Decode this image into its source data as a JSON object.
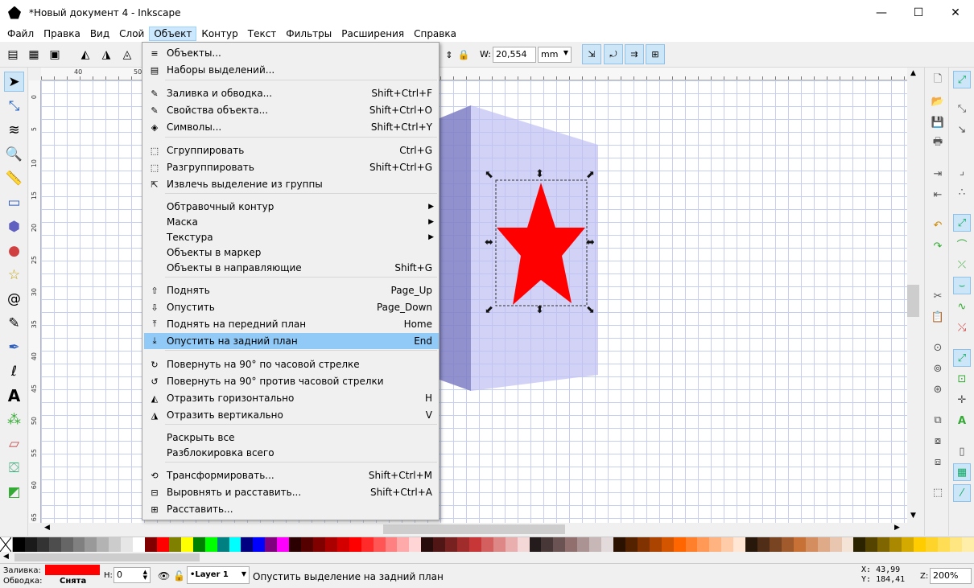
{
  "window": {
    "title": "*Новый документ 4 - Inkscape",
    "minimize": "—",
    "maximize": "☐",
    "close": "✕"
  },
  "menubar": {
    "items": [
      "Файл",
      "Правка",
      "Вид",
      "Слой",
      "Объект",
      "Контур",
      "Текст",
      "Фильтры",
      "Расширения",
      "Справка"
    ],
    "active": "Объект"
  },
  "toolbar": {
    "w_label": "W:",
    "w_value": "20,554",
    "unit": "mm"
  },
  "object_menu": {
    "items": [
      {
        "label": "Объекты...",
        "shortcut": "",
        "icon": "objects-icon"
      },
      {
        "label": "Наборы выделений...",
        "shortcut": "",
        "icon": "selection-sets-icon"
      },
      {
        "label": "Заливка и обводка...",
        "shortcut": "Shift+Ctrl+F",
        "icon": "fill-stroke-icon"
      },
      {
        "label": "Свойства объекта...",
        "shortcut": "Shift+Ctrl+O",
        "icon": "object-properties-icon"
      },
      {
        "label": "Символы...",
        "shortcut": "Shift+Ctrl+Y",
        "icon": "symbols-icon"
      },
      {
        "label": "Сгруппировать",
        "shortcut": "Ctrl+G",
        "icon": "group-icon"
      },
      {
        "label": "Разгруппировать",
        "shortcut": "Shift+Ctrl+G",
        "icon": "ungroup-icon"
      },
      {
        "label": "Извлечь выделение из группы",
        "shortcut": "",
        "icon": "pop-from-group-icon"
      },
      {
        "label": "Обтравочный контур",
        "shortcut": "",
        "icon": "",
        "submenu": true
      },
      {
        "label": "Маска",
        "shortcut": "",
        "icon": "",
        "submenu": true
      },
      {
        "label": "Текстура",
        "shortcut": "",
        "icon": "",
        "submenu": true
      },
      {
        "label": "Объекты в маркер",
        "shortcut": "",
        "icon": ""
      },
      {
        "label": "Объекты в направляющие",
        "shortcut": "Shift+G",
        "icon": ""
      },
      {
        "label": "Поднять",
        "shortcut": "Page_Up",
        "icon": "raise-icon"
      },
      {
        "label": "Опустить",
        "shortcut": "Page_Down",
        "icon": "lower-icon"
      },
      {
        "label": "Поднять на передний план",
        "shortcut": "Home",
        "icon": "raise-to-top-icon"
      },
      {
        "label": "Опустить на задний план",
        "shortcut": "End",
        "icon": "lower-to-bottom-icon",
        "highlighted": true
      },
      {
        "label": "Повернуть на 90° по часовой стрелке",
        "shortcut": "",
        "icon": "rotate-cw-icon"
      },
      {
        "label": "Повернуть на 90° против часовой стрелки",
        "shortcut": "",
        "icon": "rotate-ccw-icon"
      },
      {
        "label": "Отразить горизонтально",
        "shortcut": "H",
        "icon": "flip-horizontal-icon"
      },
      {
        "label": "Отразить вертикально",
        "shortcut": "V",
        "icon": "flip-vertical-icon"
      },
      {
        "label": "Раскрыть все",
        "shortcut": "",
        "icon": ""
      },
      {
        "label": "Разблокировка всего",
        "shortcut": "",
        "icon": ""
      },
      {
        "label": "Трансформировать...",
        "shortcut": "Shift+Ctrl+M",
        "icon": "transform-icon"
      },
      {
        "label": "Выровнять и расставить...",
        "shortcut": "Shift+Ctrl+A",
        "icon": "align-distribute-icon"
      },
      {
        "label": "Расставить...",
        "shortcut": "",
        "icon": "arrange-icon"
      }
    ]
  },
  "ruler": {
    "h_labels": [
      "40",
      "50"
    ],
    "v_labels": [
      "0",
      "5",
      "10",
      "15",
      "20",
      "25",
      "30",
      "35",
      "40",
      "45",
      "50",
      "55",
      "60",
      "65"
    ]
  },
  "palette": [
    "#000000",
    "#1a1a1a",
    "#333333",
    "#4d4d4d",
    "#666666",
    "#808080",
    "#999999",
    "#b3b3b3",
    "#cccccc",
    "#e6e6e6",
    "#ffffff",
    "#800000",
    "#ff0000",
    "#808000",
    "#ffff00",
    "#008000",
    "#00ff00",
    "#008080",
    "#00ffff",
    "#000080",
    "#0000ff",
    "#800080",
    "#ff00ff",
    "#2b0000",
    "#550000",
    "#800000",
    "#aa0000",
    "#d40000",
    "#ff0000",
    "#ff2a2a",
    "#ff5555",
    "#ff8080",
    "#ffaaaa",
    "#ffd5d5",
    "#280b0b",
    "#501616",
    "#782121",
    "#a02c2c",
    "#c83737",
    "#d35f5f",
    "#de8787",
    "#e9afaf",
    "#f4d7d7",
    "#241c1c",
    "#483737",
    "#6c5353",
    "#916f6f",
    "#ac9393",
    "#c8b7b7",
    "#e3dbdb",
    "#2b1100",
    "#552200",
    "#803300",
    "#aa4400",
    "#d45500",
    "#ff6600",
    "#ff7f2a",
    "#ff9955",
    "#ffb380",
    "#ffccaa",
    "#ffe6d5",
    "#28170b",
    "#502d16",
    "#784421",
    "#a05a2c",
    "#c87137",
    "#d38d5f",
    "#deaa87",
    "#e9c6af",
    "#f4e3d7",
    "#2b2200",
    "#554400",
    "#806600",
    "#aa8800",
    "#d4aa00",
    "#ffcc00",
    "#ffd42a",
    "#ffdd55",
    "#ffe680",
    "#ffeeaa"
  ],
  "status": {
    "fill_label": "Заливка:",
    "stroke_label": "Обводка:",
    "stroke_value": "Снята",
    "fill_color": "#ff0000",
    "h_label": "H:",
    "h_value": "0",
    "layer": "•Layer 1",
    "message": "Опустить выделение на задний план",
    "x_label": "X:",
    "x_value": "43,99",
    "y_label": "Y:",
    "y_value": "184,41",
    "z_label": "Z:",
    "zoom": "200%"
  },
  "colors": {
    "star": "#ff0000",
    "box_front": "#d6d6fa",
    "box_side": "#8888d0",
    "menu_highlight": "#91c9f7"
  }
}
